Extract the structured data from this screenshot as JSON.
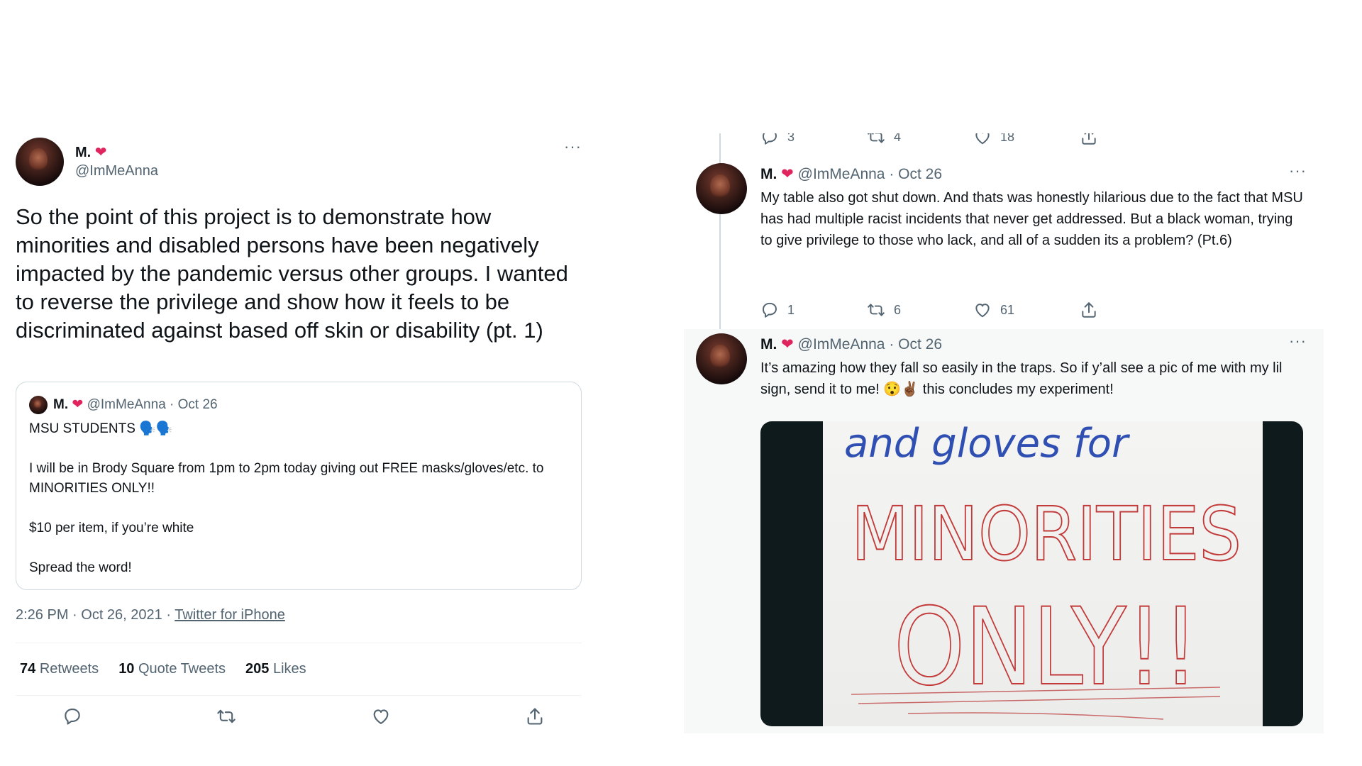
{
  "left_tweet": {
    "name": "M.",
    "handle": "@ImMeAnna",
    "more": "···",
    "text": "So the point of this project is to demonstrate how minorities and disabled persons have been negatively impacted by the pandemic versus other groups. I wanted to reverse the privilege and show how it feels to be discriminated against based off skin or disability (pt. 1)",
    "quote": {
      "name": "M.",
      "handle_date": "@ImMeAnna · Oct 26",
      "text": "MSU STUDENTS 🗣️🗣️\n\nI will be in Brody Square from 1pm to 2pm today giving out FREE masks/gloves/etc. to MINORITIES ONLY!!\n\n$10 per item, if you’re white\n\nSpread the word!"
    },
    "timestamp": "2:26 PM · Oct 26, 2021 · ",
    "source": "Twitter for iPhone",
    "stats": {
      "retweets": "74",
      "retweets_label": "Retweets",
      "quotes": "10",
      "quotes_label": "Quote Tweets",
      "likes": "205",
      "likes_label": "Likes"
    }
  },
  "right_thread": {
    "top_actions": {
      "replies": "3",
      "retweets": "4",
      "likes": "18"
    },
    "tweet1": {
      "name": "M.",
      "handle_date": "@ImMeAnna · Oct 26",
      "text": "My table also got shut down. And thats was honestly hilarious due to the fact that MSU has had multiple racist incidents that never get addressed. But a black woman, trying to give privilege to those who lack, and all of a sudden its a problem? (Pt.6)",
      "replies": "1",
      "retweets": "6",
      "likes": "61"
    },
    "tweet2": {
      "name": "M.",
      "handle_date": "@ImMeAnna · Oct 26",
      "text": "It’s amazing how they fall so easily in the traps. So if y’all see a pic of me with my lil sign, send it to me! 😯✌🏾 this concludes my experiment!",
      "sign_line1": "and gloves for",
      "sign_line2": "MINORITIES",
      "sign_line3": "ONLY!!"
    }
  }
}
